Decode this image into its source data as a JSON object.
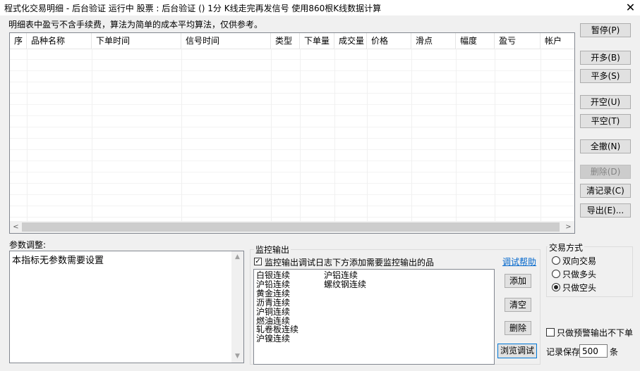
{
  "window": {
    "title": "程式化交易明细 - 后台验证 运行中  股票 : 后台验证 () 1分  K线走完再发信号  使用860根K线数据计算",
    "close_glyph": "✕"
  },
  "note": "明细表中盈亏不含手续费，算法为简单的成本平均算法，仅供参考。",
  "table": {
    "columns": [
      "序",
      "品种名称",
      "下单时间",
      "信号时间",
      "类型",
      "下单量",
      "成交量",
      "价格",
      "滑点",
      "幅度",
      "盈亏",
      "帐户"
    ],
    "rows": []
  },
  "buttons": {
    "pause": "暂停(P)",
    "open_long": "开多(B)",
    "close_long": "平多(S)",
    "open_short": "开空(U)",
    "close_short": "平空(T)",
    "cancel_all": "全撤(N)",
    "delete": "删除(D)",
    "clear_records": "清记录(C)",
    "export": "导出(E)..."
  },
  "params": {
    "label": "参数调整:",
    "text": "本指标无参数需要设置"
  },
  "monitor": {
    "label": "监控输出",
    "checkbox_label": "监控输出调试日志下方添加需要监控输出的品",
    "checkbox_checked": true,
    "help_link": "调试帮助",
    "items_col1": [
      "白银连续",
      "沪铅连续",
      "黄金连续",
      "沥青连续",
      "沪铜连续",
      "燃油连续",
      "轧卷板连续",
      "沪镍连续"
    ],
    "items_col2": [
      "沪铝连续",
      "螺纹钢连续"
    ],
    "add": "添加",
    "clear": "清空",
    "remove": "删除",
    "browse": "浏览调试"
  },
  "trade_mode": {
    "label": "交易方式",
    "options": [
      "双向交易",
      "只做多头",
      "只做空头"
    ],
    "selected": "只做空头"
  },
  "alert_only": {
    "label": "只做预警输出不下单",
    "checked": false
  },
  "record_keep": {
    "label": "记录保存",
    "value": "500",
    "unit": "条"
  }
}
